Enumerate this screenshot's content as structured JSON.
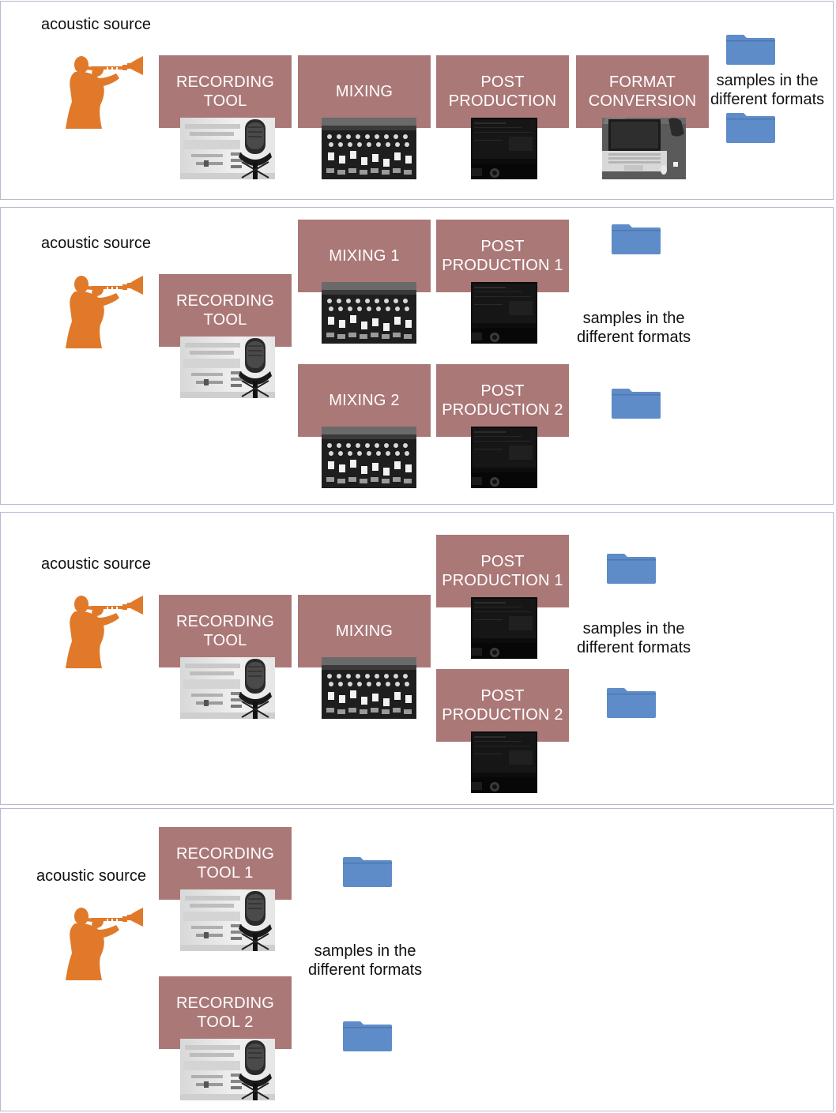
{
  "colors": {
    "stage_fill": "#ab7878",
    "stage_text": "#ffffff",
    "folder": "#5e8cc9",
    "trumpeter": "#e07a2a",
    "panel_border": "#b8b8d0"
  },
  "icons": {
    "source": "trumpet-player-icon",
    "output": "folder-icon",
    "recording_photo": "studio-microphone-photo",
    "mixing_photo": "mixing-console-photo",
    "post_photo": "daw-monitor-photo",
    "conversion_photo": "laptop-desk-photo"
  },
  "panels": [
    {
      "source_label": "acoustic source",
      "stages": [
        "RECORDING\nTOOL",
        "MIXING",
        "POST\nPRODUCTION",
        "FORMAT\nCONVERSION"
      ],
      "output_label": "samples in the\ndifferent formats"
    },
    {
      "source_label": "acoustic source",
      "stages": [
        "RECORDING\nTOOL",
        "MIXING 1",
        "POST\nPRODUCTION 1",
        "MIXING 2",
        "POST\nPRODUCTION 2"
      ],
      "output_label": "samples in the\ndifferent formats"
    },
    {
      "source_label": "acoustic source",
      "stages": [
        "RECORDING\nTOOL",
        "MIXING",
        "POST\nPRODUCTION 1",
        "POST\nPRODUCTION 2"
      ],
      "output_label": "samples in the\ndifferent formats"
    },
    {
      "source_label": "acoustic source",
      "stages": [
        "RECORDING\nTOOL 1",
        "RECORDING\nTOOL 2"
      ],
      "output_label": "samples in the\ndifferent formats"
    }
  ]
}
